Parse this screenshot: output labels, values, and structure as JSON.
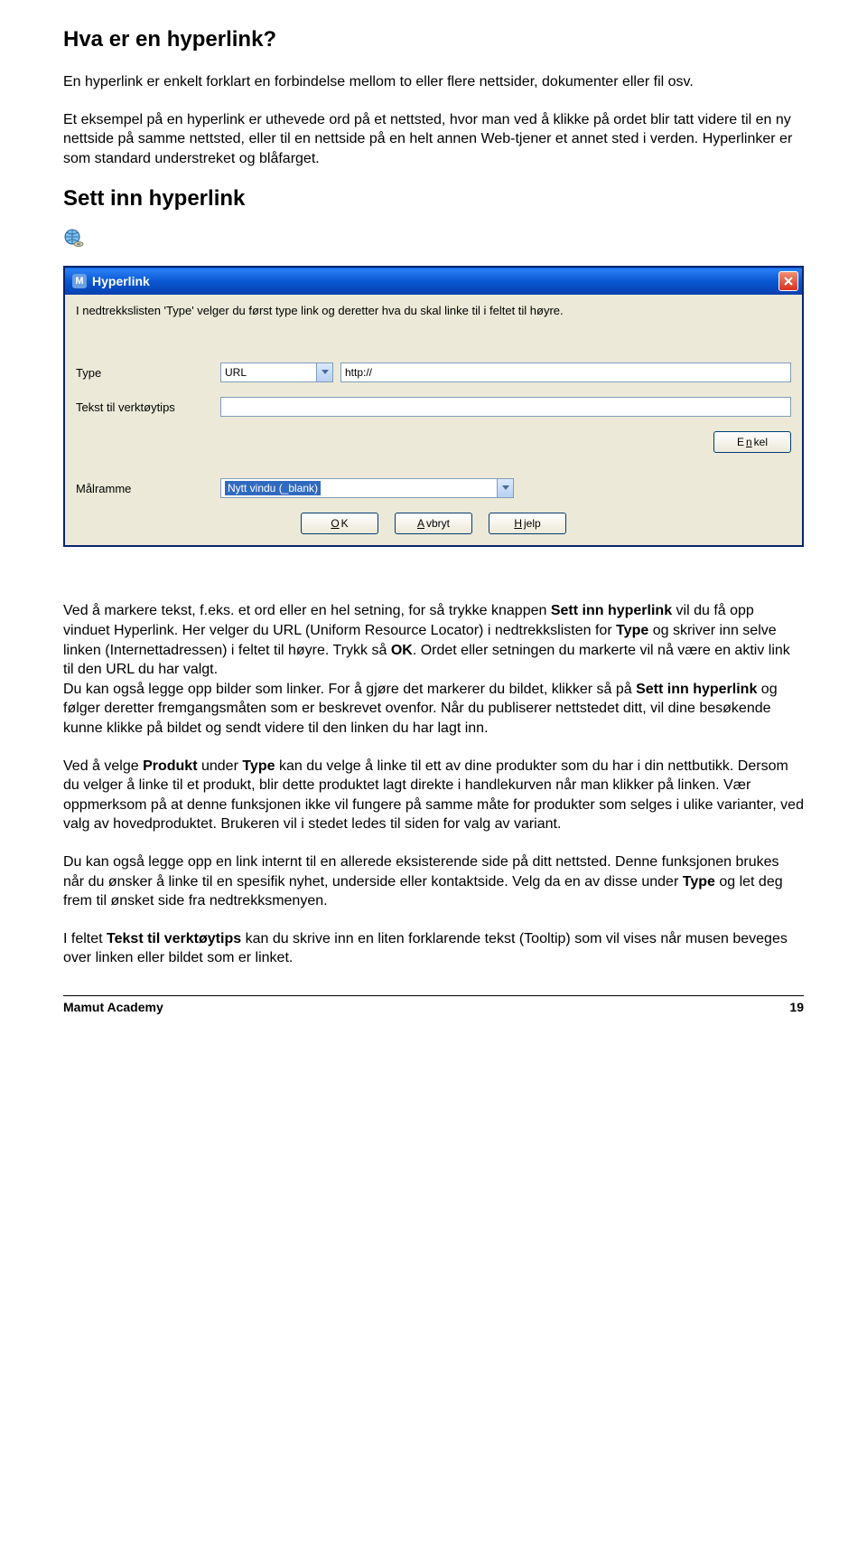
{
  "heading1": "Hva er en hyperlink?",
  "para1": "En hyperlink er enkelt forklart en forbindelse mellom to eller flere nettsider, dokumenter eller fil osv.",
  "para2": "Et eksempel på en hyperlink er uthevede ord på et nettsted, hvor man ved å klikke på ordet blir tatt videre til en ny nettside på samme nettsted, eller til en nettside på en helt annen Web-tjener et annet sted i verden. Hyperlinker er som standard understreket og blåfarget.",
  "heading2": "Sett inn hyperlink",
  "dialog": {
    "title": "Hyperlink",
    "desc": "I nedtrekkslisten 'Type' velger du først type link og deretter hva du skal linke til i feltet til høyre.",
    "labels": {
      "type": "Type",
      "tooltip": "Tekst til verktøytips",
      "targetframe": "Målramme"
    },
    "type_value": "URL",
    "url_value": "http://",
    "targetframe_value": "Nytt vindu (_blank)",
    "buttons": {
      "simple_pre": "E",
      "simple_u": "n",
      "simple_post": "kel",
      "ok_u": "O",
      "ok_post": "K",
      "cancel_u": "A",
      "cancel_post": "vbryt",
      "help_u": "H",
      "help_post": "jelp"
    }
  },
  "para3a": "Ved å markere tekst, f.eks. et ord eller en hel setning, for så trykke knappen ",
  "para3b": "Sett inn hyperlink",
  "para3c": " vil du få opp vinduet Hyperlink. Her velger du URL (Uniform Resource Locator) i nedtrekkslisten for ",
  "para3d": "Type",
  "para3e": " og skriver inn selve linken (Internettadressen) i feltet til høyre. Trykk så ",
  "para3f": "OK",
  "para3g": ". Ordet eller setningen du markerte vil nå være en aktiv link til den URL du har valgt.",
  "para3h": "Du kan også legge opp bilder som linker. For å gjøre det markerer du bildet, klikker så på ",
  "para3i": "Sett inn hyperlink",
  "para3j": " og følger deretter fremgangsmåten som er beskrevet ovenfor. Når du publiserer nettstedet ditt, vil dine besøkende kunne klikke på bildet og sendt videre til den linken du har lagt inn.",
  "para4a": "Ved å velge ",
  "para4b": "Produkt",
  "para4c": " under ",
  "para4d": "Type",
  "para4e": " kan du velge å linke til ett av dine produkter som du har i din nettbutikk. Dersom du velger å linke til et produkt, blir dette produktet lagt direkte i handlekurven når man klikker på linken. Vær oppmerksom på at denne funksjonen ikke vil fungere på samme måte for produkter som selges i ulike varianter, ved valg av hovedproduktet. Brukeren vil i stedet ledes til siden for valg av variant.",
  "para5a": "Du kan også legge opp en link internt til en allerede eksisterende side på ditt nettsted. Denne funksjonen brukes når du ønsker å linke til en spesifik nyhet, underside eller kontaktside. Velg da en av disse under ",
  "para5b": "Type",
  "para5c": " og let deg frem til ønsket side fra nedtrekksmenyen.",
  "para6a": "I feltet ",
  "para6b": "Tekst til verktøytips",
  "para6c": " kan du skrive inn en liten forklarende tekst (Tooltip) som vil vises når musen beveges over linken eller bildet som er linket.",
  "footer": {
    "left": "Mamut Academy",
    "right": "19"
  }
}
